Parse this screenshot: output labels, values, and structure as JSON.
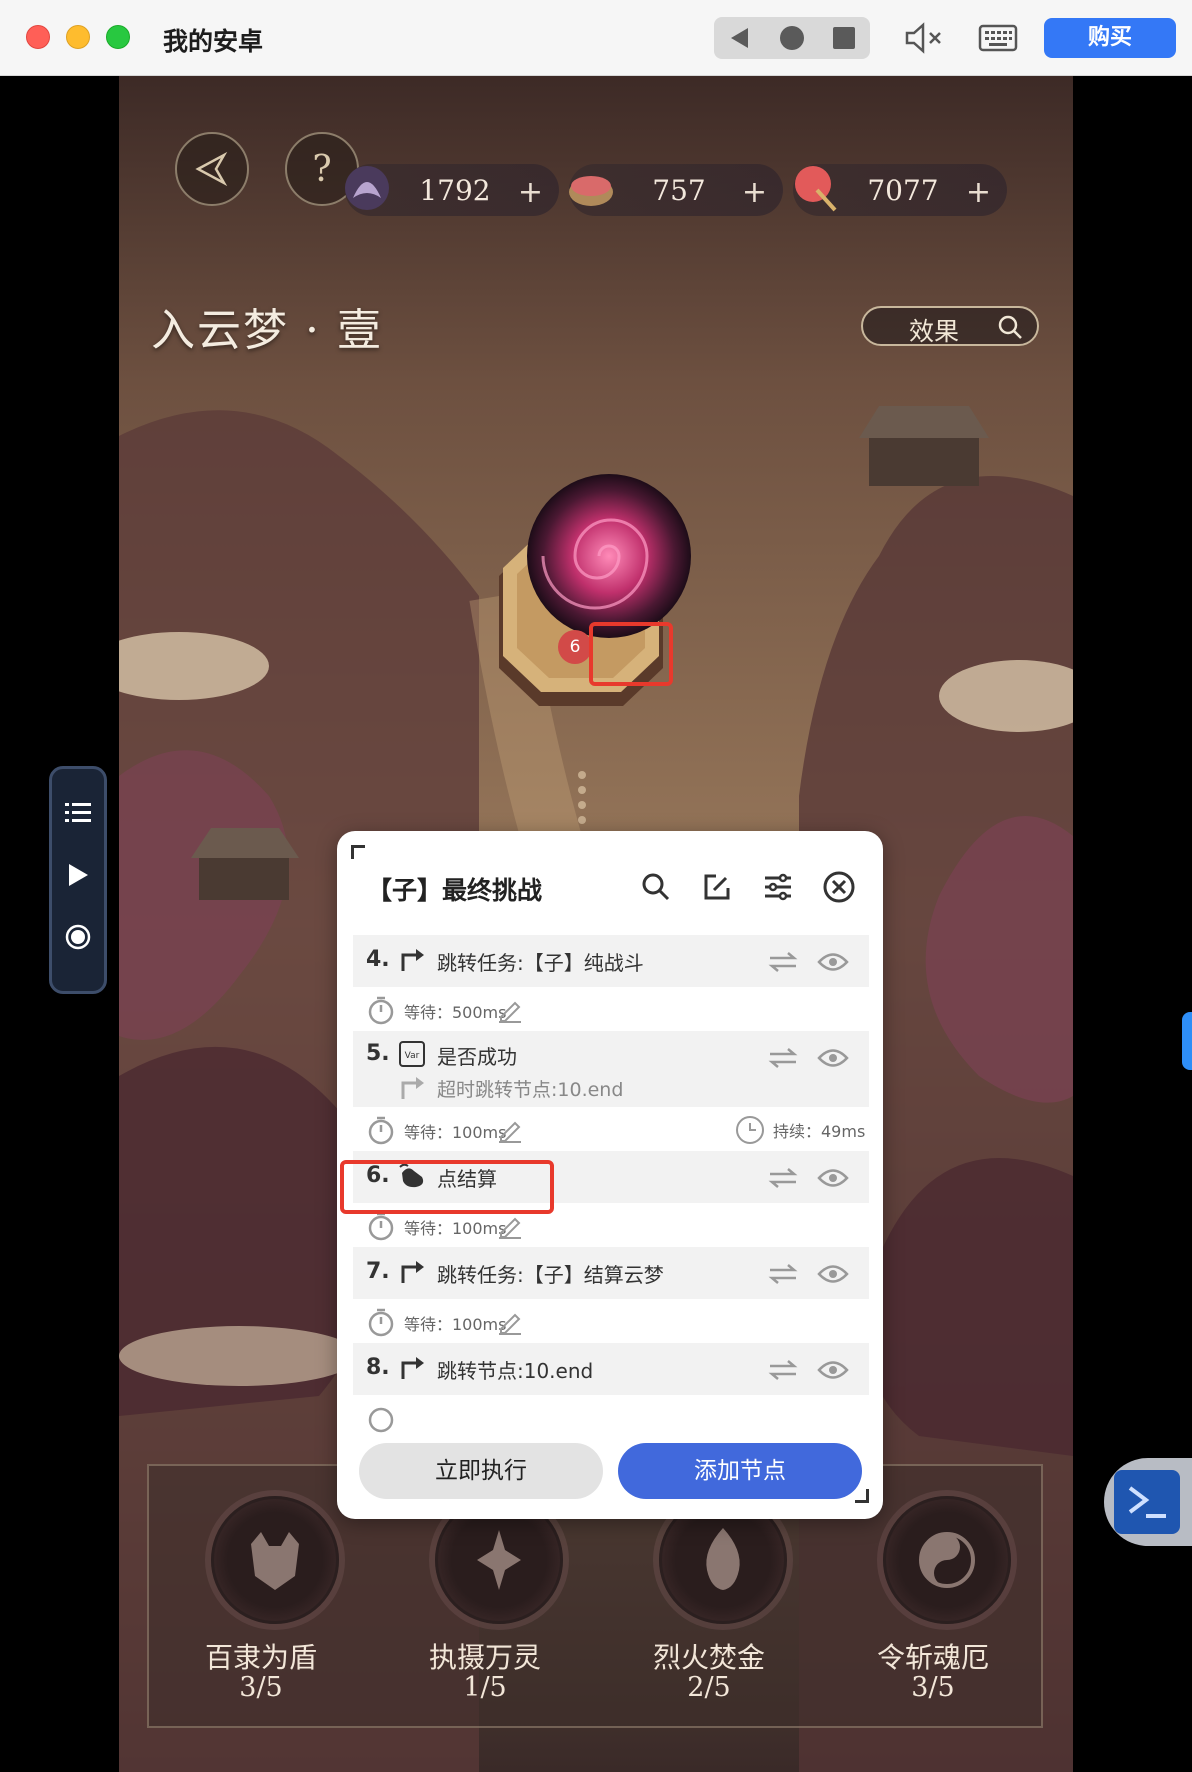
{
  "window": {
    "title": "我的安卓",
    "buy_label": "购买",
    "nav_icons": [
      "back-icon",
      "home-icon",
      "recents-icon"
    ],
    "tool_icons": [
      "mute-icon",
      "keyboard-icon"
    ]
  },
  "game": {
    "resources": [
      {
        "icon": "crystal-icon",
        "value": "1792",
        "plus": "+"
      },
      {
        "icon": "chest-icon",
        "value": "757",
        "plus": "+"
      },
      {
        "icon": "fan-icon",
        "value": "7077",
        "plus": "+"
      }
    ],
    "help_glyph": "?",
    "stage_title": "入云梦 · 壹",
    "effect_label": "效果",
    "node_badge": "6",
    "skills": [
      {
        "name": "百隶为盾",
        "value": "3/5"
      },
      {
        "name": "执摄万灵",
        "value": "1/5"
      },
      {
        "name": "烈火焚金",
        "value": "2/5"
      },
      {
        "name": "令斩魂厄",
        "value": "3/5"
      }
    ]
  },
  "panel": {
    "title": "【子】最终挑战",
    "header_icons": [
      "search-icon",
      "edit-icon",
      "settings-sliders-icon",
      "close-icon"
    ],
    "rows": [
      {
        "num": "4.",
        "icon": "jump-icon",
        "label": "跳转任务:【子】纯战斗",
        "wait": "等待：500ms"
      },
      {
        "num": "5.",
        "icon": "var-icon",
        "label": "是否成功",
        "sub": "超时跳转节点:10.end",
        "wait": "等待：100ms",
        "duration": "持续：49ms"
      },
      {
        "num": "6.",
        "icon": "tap-icon",
        "label": "点结算",
        "wait": "等待：100ms"
      },
      {
        "num": "7.",
        "icon": "jump-icon",
        "label": "跳转任务:【子】结算云梦",
        "wait": "等待：100ms"
      },
      {
        "num": "8.",
        "icon": "jump-icon",
        "label": "跳转节点:10.end"
      }
    ],
    "exec_label": "立即执行",
    "add_label": "添加节点"
  },
  "colors": {
    "accent_blue": "#4169dc",
    "buy_blue": "#3478f6",
    "highlight_red": "#e8392c"
  }
}
